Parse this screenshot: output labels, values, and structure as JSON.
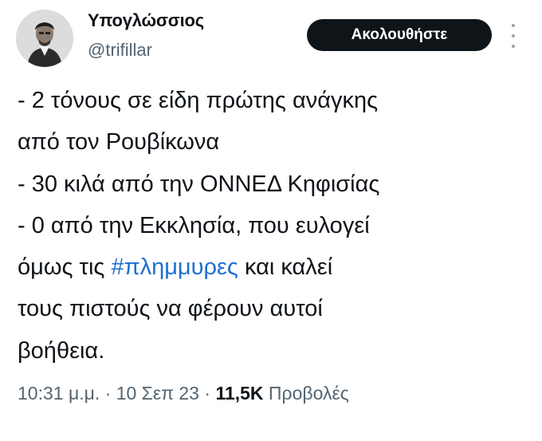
{
  "author": {
    "display_name": "Υπογλώσσιος",
    "handle": "@trifillar"
  },
  "follow_button_label": "Ακολουθήστε",
  "tweet": {
    "lines": [
      "- 2 τόνους σε είδη πρώτης ανάγκης",
      "από τον Ρουβίκωνα",
      "- 30 κιλά από την  ΟΝΝΕΔ Κηφισίας",
      "- 0 από την Εκκλησία, που ευλογεί"
    ],
    "line5_prefix": "όμως τις ",
    "hashtag": "#πλημμυρες",
    "line5_suffix": " και καλεί",
    "line6": "τους πιστούς να φέρουν αυτοί",
    "line7": "βοήθεια."
  },
  "meta": {
    "time": "10:31 μ.μ.",
    "separator": " · ",
    "date": "10 Σεπ 23",
    "views_count": "11,5K",
    "views_label": " Προβολές"
  },
  "colors": {
    "text": "#0f1419",
    "secondary": "#536471",
    "hashtag": "#1d6fd1",
    "button_bg": "#0f1419"
  }
}
